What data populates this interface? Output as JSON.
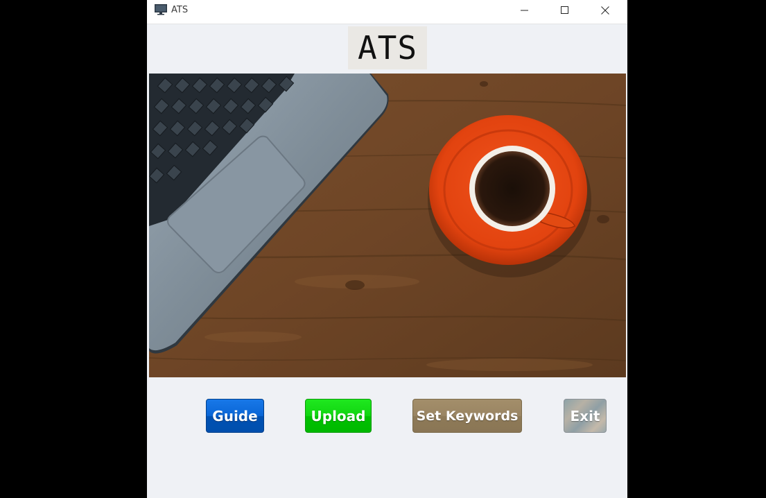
{
  "window": {
    "title": "ATS",
    "controls": {
      "minimize": "minimize",
      "maximize": "maximize",
      "close": "close"
    }
  },
  "header": {
    "heading": "ATS"
  },
  "hero": {
    "image": "laptop-and-coffee-on-wooden-desk"
  },
  "actions": {
    "guide_label": "Guide",
    "upload_label": "Upload",
    "set_keywords_label": "Set Keywords",
    "exit_label": "Exit"
  },
  "colors": {
    "guide": "#0a66d6",
    "upload": "#10d510",
    "set_keywords": "#9a8563",
    "exit": "#a8aba6",
    "background": "#eff1f5"
  }
}
